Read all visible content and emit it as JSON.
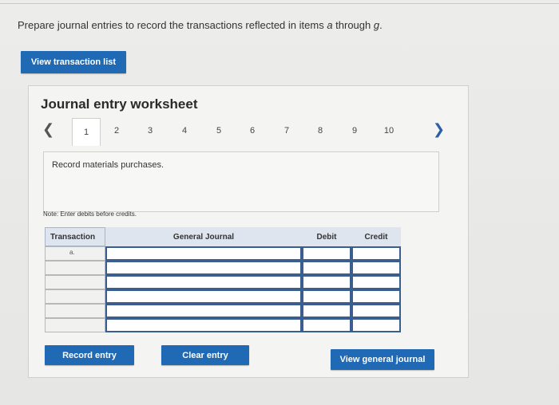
{
  "prompt": {
    "text_before": "Prepare journal entries to record the transactions reflected in items ",
    "item_a": "a",
    "text_mid": " through ",
    "item_g": "g",
    "text_end": "."
  },
  "buttons": {
    "view_transaction_list": "View transaction list",
    "record_entry": "Record entry",
    "clear_entry": "Clear entry",
    "view_general_journal": "View general journal"
  },
  "worksheet": {
    "title": "Journal entry worksheet",
    "tabs": [
      "1",
      "2",
      "3",
      "4",
      "5",
      "6",
      "7",
      "8",
      "9",
      "10"
    ],
    "active_tab": "1",
    "description": "Record materials purchases.",
    "note": "Note: Enter debits before credits."
  },
  "table": {
    "headers": {
      "transaction": "Transaction",
      "general_journal": "General Journal",
      "debit": "Debit",
      "credit": "Credit"
    },
    "rows": [
      {
        "transaction": "a.",
        "account": "",
        "debit": "",
        "credit": ""
      },
      {
        "transaction": "",
        "account": "",
        "debit": "",
        "credit": ""
      },
      {
        "transaction": "",
        "account": "",
        "debit": "",
        "credit": ""
      },
      {
        "transaction": "",
        "account": "",
        "debit": "",
        "credit": ""
      },
      {
        "transaction": "",
        "account": "",
        "debit": "",
        "credit": ""
      },
      {
        "transaction": "",
        "account": "",
        "debit": "",
        "credit": ""
      }
    ]
  },
  "icons": {
    "prev": "chevron-left-icon",
    "next": "chevron-right-icon"
  },
  "colors": {
    "accent": "#1f69b5",
    "table_border": "#3a5f8f",
    "header_bg": "#dfe5ee"
  }
}
